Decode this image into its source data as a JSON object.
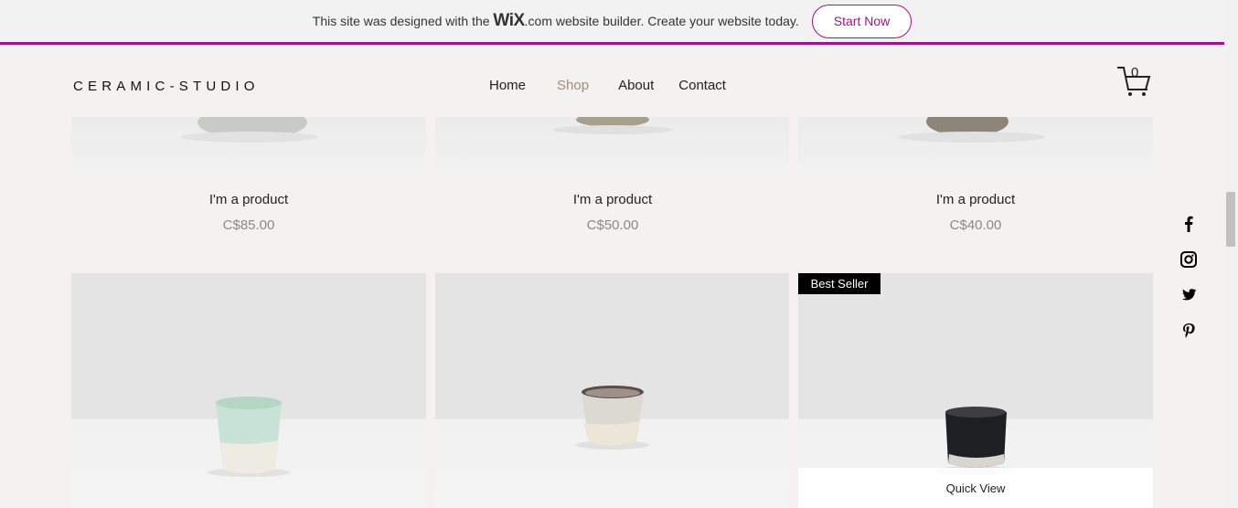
{
  "wix_banner": {
    "text_before": "This site was designed with the ",
    "brand": "WiX",
    "text_after": ".com website builder. Create your website today.",
    "button_label": "Start Now",
    "accent_color": "#a0138e"
  },
  "header": {
    "logo": "CERAMIC-STUDIO",
    "nav": [
      {
        "label": "Home",
        "active": false
      },
      {
        "label": "Shop",
        "active": true
      },
      {
        "label": "About",
        "active": false
      },
      {
        "label": "Contact",
        "active": false
      }
    ],
    "cart_count": "0",
    "cart_icon": "cart-icon"
  },
  "products_top": [
    {
      "name": "I'm a product",
      "price": "C$85.00"
    },
    {
      "name": "I'm a product",
      "price": "C$50.00"
    },
    {
      "name": "I'm a product",
      "price": "C$40.00"
    }
  ],
  "products_bottom": [
    {
      "badge": "",
      "cup_color": "mint"
    },
    {
      "badge": "",
      "cup_color": "speckled-grey"
    },
    {
      "badge": "Best Seller",
      "cup_color": "black",
      "quick_view": "Quick View"
    }
  ],
  "social_icons": [
    "facebook-icon",
    "instagram-icon",
    "twitter-icon",
    "pinterest-icon"
  ]
}
